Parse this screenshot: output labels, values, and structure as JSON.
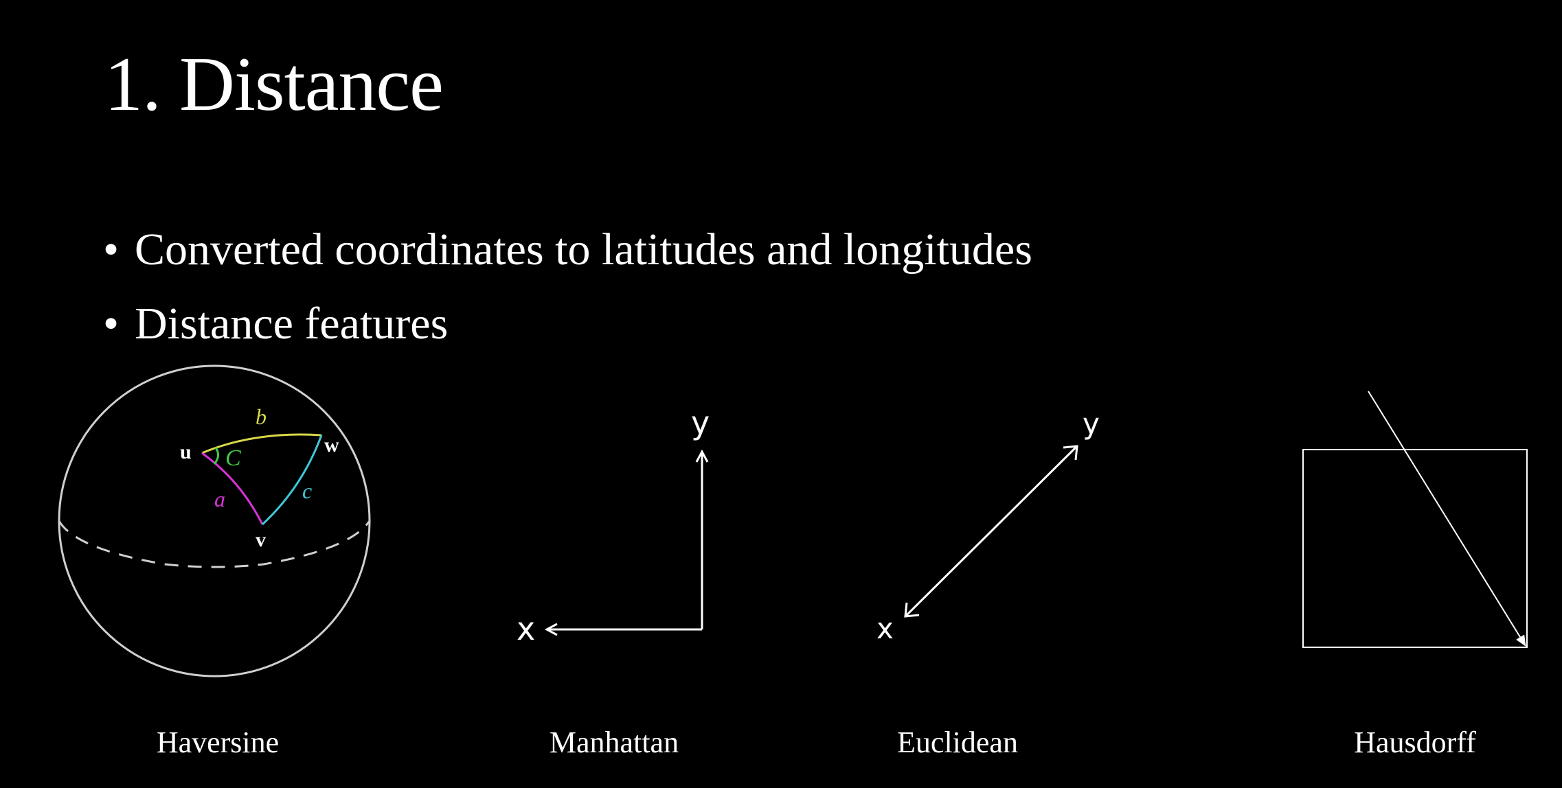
{
  "slide": {
    "title": "1. Distance",
    "bullets": [
      "Converted coordinates to latitudes and longitudes",
      "Distance features"
    ]
  },
  "panels": {
    "haversine": {
      "caption": "Haversine",
      "labels": {
        "u": "u",
        "v": "v",
        "w": "w",
        "a": "a",
        "b": "b",
        "c": "c",
        "C": "C"
      },
      "colors": {
        "a": "#d633d6",
        "b": "#d8d84a",
        "c": "#3fc8d8",
        "C": "#3fc84a",
        "sphere": "#cfcfcf"
      }
    },
    "manhattan": {
      "caption": "Manhattan",
      "labels": {
        "x": "x",
        "y": "y"
      }
    },
    "euclidean": {
      "caption": "Euclidean",
      "labels": {
        "x": "x",
        "y": "y"
      }
    },
    "hausdorff": {
      "caption": "Hausdorff"
    }
  },
  "colors": {
    "background": "#000000",
    "foreground": "#ffffff"
  }
}
